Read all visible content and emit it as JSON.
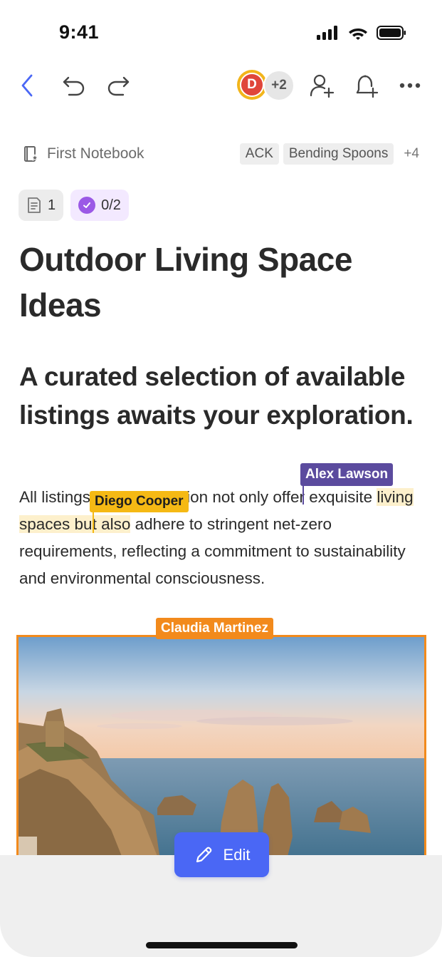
{
  "status_bar": {
    "time": "9:41"
  },
  "toolbar": {
    "back_icon": "chevron-left-icon",
    "undo_icon": "undo-icon",
    "redo_icon": "redo-icon",
    "avatar_initial": "D",
    "collaborators_more": "+2",
    "add_user_icon": "add-user-icon",
    "reminder_icon": "add-reminder-icon",
    "more_icon": "more-icon",
    "accent_color": "#4A67F5"
  },
  "meta": {
    "notebook": "First Notebook",
    "tags": [
      "ACK",
      "Bending Spoons"
    ],
    "tags_more": "+4"
  },
  "chips": {
    "notes_count": "1",
    "tasks_progress": "0/2"
  },
  "note": {
    "title": "Outdoor Living Space Ideas",
    "subtitle": "A curated selection of available listings awaits your exploration.",
    "paragraph": {
      "part1": "All listings in this collection not only offer exquisite ",
      "highlight": "living spaces but also",
      "part2": " adhere to stringent net-zero requirements, reflecting a commitment to sustainability and environmental consciousness."
    }
  },
  "collaborators": {
    "diego": {
      "name": "Diego Cooper",
      "color": "#F5B914"
    },
    "alex": {
      "name": "Alex Lawson",
      "color": "#5B4B9E"
    },
    "claudia": {
      "name": "Claudia Martinez",
      "color": "#F28A1C"
    }
  },
  "edit_button": {
    "label": "Edit"
  }
}
